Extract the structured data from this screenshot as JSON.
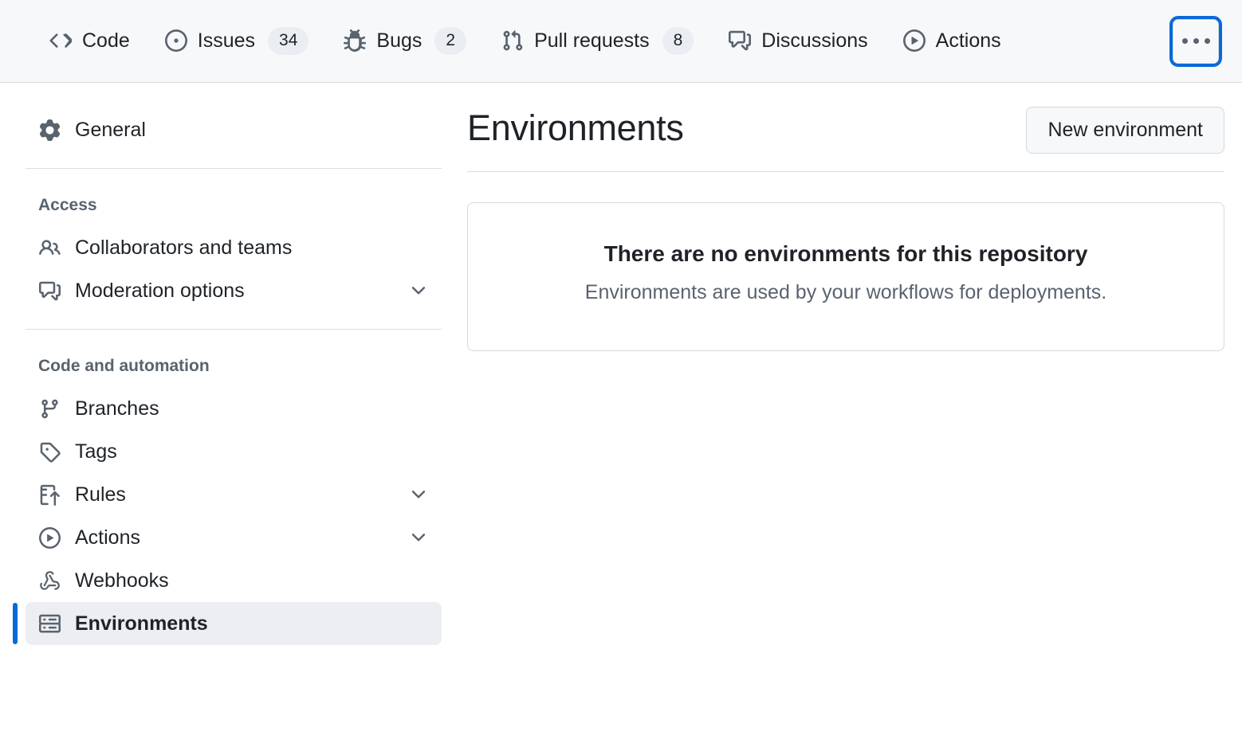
{
  "topnav": {
    "items": [
      {
        "label": "Code",
        "icon": "code-icon",
        "count": null
      },
      {
        "label": "Issues",
        "icon": "issue-opened-icon",
        "count": "34"
      },
      {
        "label": "Bugs",
        "icon": "bug-icon",
        "count": "2"
      },
      {
        "label": "Pull requests",
        "icon": "git-pull-request-icon",
        "count": "8"
      },
      {
        "label": "Discussions",
        "icon": "comment-discussion-icon",
        "count": null
      },
      {
        "label": "Actions",
        "icon": "play-circle-icon",
        "count": null
      }
    ],
    "overflow": {
      "name": "kebab-horizontal-icon",
      "focused": true,
      "focus_color": "#0969da"
    }
  },
  "sidebar": {
    "top_items": [
      {
        "label": "General",
        "icon": "gear-icon"
      }
    ],
    "groups": [
      {
        "title": "Access",
        "items": [
          {
            "label": "Collaborators and teams",
            "icon": "people-icon",
            "expandable": false
          },
          {
            "label": "Moderation options",
            "icon": "comment-discussion-icon",
            "expandable": true
          }
        ]
      },
      {
        "title": "Code and automation",
        "items": [
          {
            "label": "Branches",
            "icon": "git-branch-icon",
            "expandable": false
          },
          {
            "label": "Tags",
            "icon": "tag-icon",
            "expandable": false
          },
          {
            "label": "Rules",
            "icon": "file-upload-icon",
            "expandable": true
          },
          {
            "label": "Actions",
            "icon": "play-circle-icon",
            "expandable": true
          },
          {
            "label": "Webhooks",
            "icon": "webhook-icon",
            "expandable": false
          },
          {
            "label": "Environments",
            "icon": "server-icon",
            "expandable": false,
            "selected": true
          }
        ]
      }
    ]
  },
  "main": {
    "title": "Environments",
    "new_button": "New environment",
    "blankslate": {
      "heading": "There are no environments for this repository",
      "description": "Environments are used by your workflows for deployments."
    }
  }
}
